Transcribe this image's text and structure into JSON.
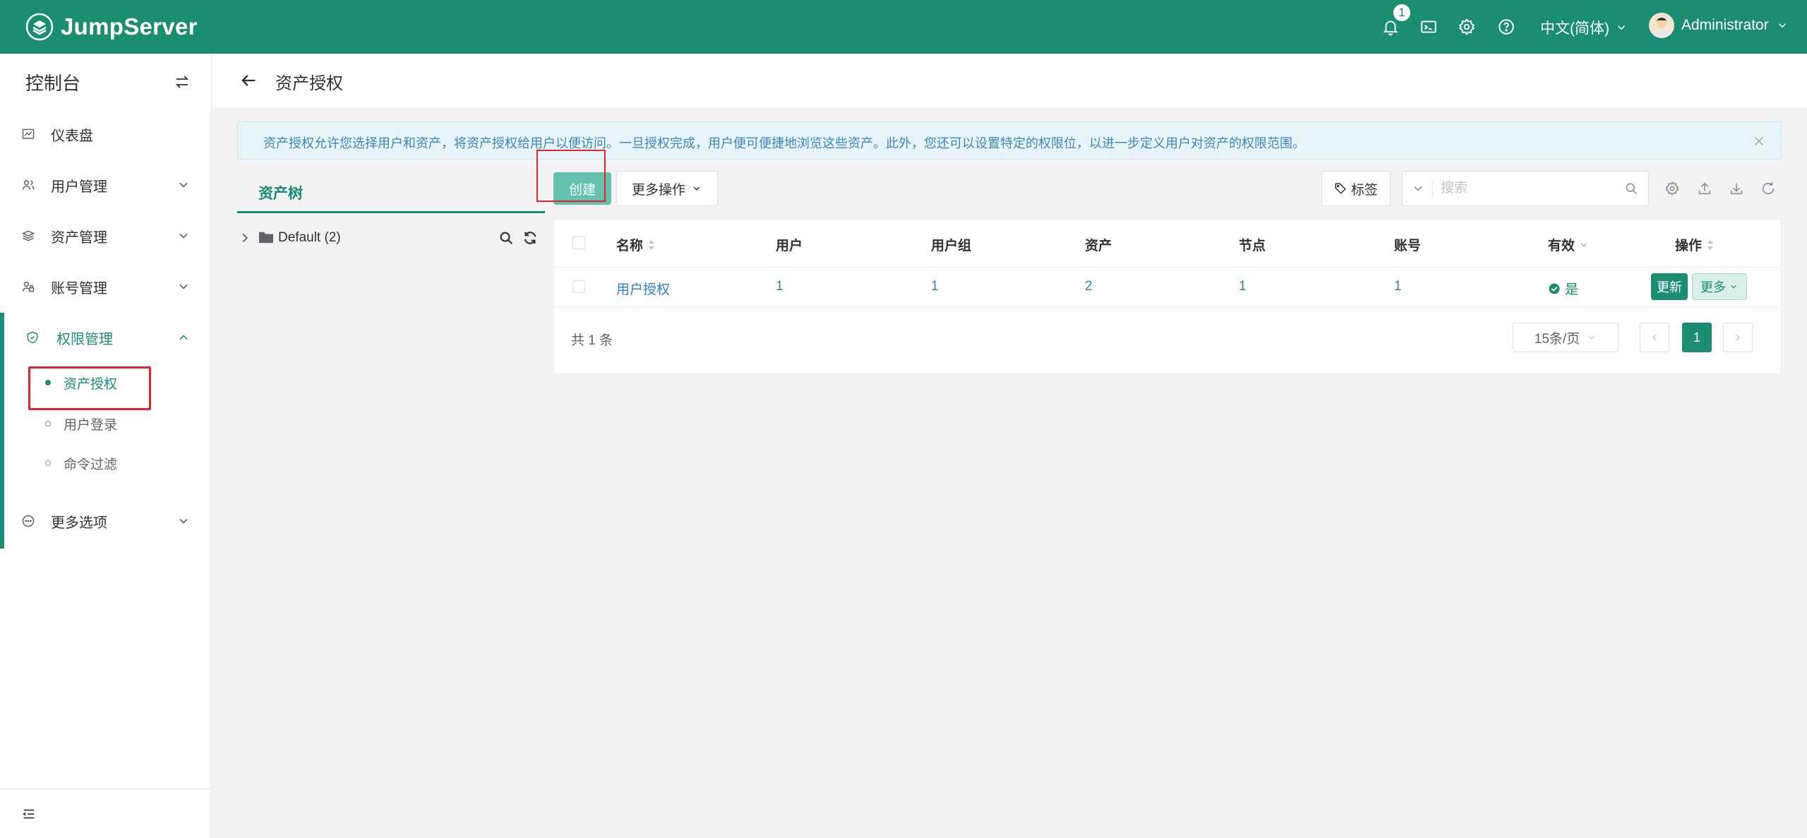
{
  "header": {
    "brand": "JumpServer",
    "notification_count": "1",
    "language": "中文(简体)",
    "username": "Administrator",
    "icons": [
      "bell-icon",
      "terminal-icon",
      "settings-icon",
      "help-icon"
    ]
  },
  "sidebar": {
    "title": "控制台",
    "items": [
      {
        "label": "仪表盘",
        "icon": "dashboard-icon"
      },
      {
        "label": "用户管理",
        "icon": "users-icon"
      },
      {
        "label": "资产管理",
        "icon": "assets-icon"
      },
      {
        "label": "账号管理",
        "icon": "accounts-icon"
      },
      {
        "label": "权限管理",
        "icon": "shield-icon"
      },
      {
        "label": "更多选项",
        "icon": "more-icon"
      }
    ],
    "sub_items": [
      {
        "label": "资产授权"
      },
      {
        "label": "用户登录"
      },
      {
        "label": "命令过滤"
      }
    ]
  },
  "page": {
    "title": "资产授权",
    "alert": "资产授权允许您选择用户和资产，将资产授权给用户以便访问。一旦授权完成，用户便可便捷地浏览这些资产。此外，您还可以设置特定的权限位，以进一步定义用户对资产的权限范围。"
  },
  "tree": {
    "tab": "资产树",
    "root": "Default (2)"
  },
  "toolbar": {
    "create": "创建",
    "more_ops": "更多操作",
    "tag": "标签",
    "search_placeholder": "搜索"
  },
  "table": {
    "columns": [
      "名称",
      "用户",
      "用户组",
      "资产",
      "节点",
      "账号",
      "有效",
      "操作"
    ],
    "rows": [
      {
        "name": "用户授权",
        "users": "1",
        "user_groups": "1",
        "assets": "2",
        "nodes": "1",
        "accounts": "1",
        "valid": "是",
        "update": "更新",
        "more": "更多"
      }
    ],
    "total": "共 1 条",
    "page_size": "15条/页",
    "current_page": "1"
  },
  "colors": {
    "brand": "#1a8d73",
    "create_button": "#63c2ad",
    "alert_bg": "#e8f4fb",
    "link": "#2f7fc1"
  }
}
